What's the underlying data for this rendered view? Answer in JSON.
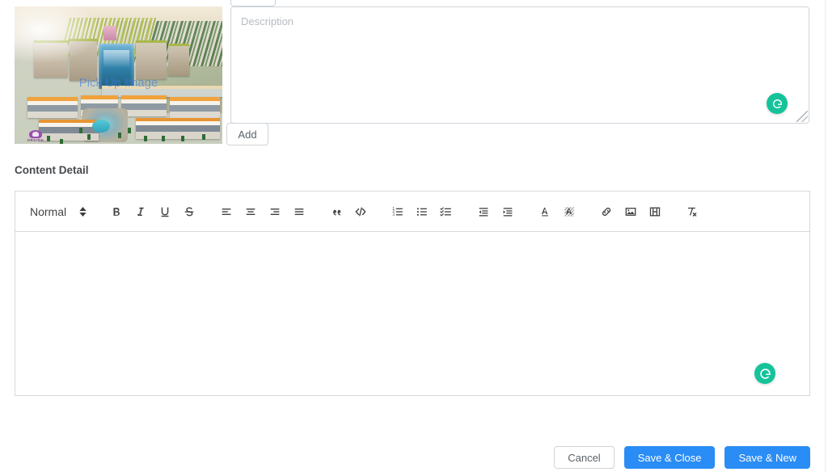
{
  "image_picker": {
    "label": "Pick Up Image",
    "watermark": "ORKIDE"
  },
  "description": {
    "placeholder": "Description",
    "value": ""
  },
  "grammarly": {
    "letter": "G",
    "color": "#15c39a"
  },
  "add_button": {
    "label": "Add"
  },
  "content_detail": {
    "label": "Content Detail"
  },
  "editor": {
    "header_picker": {
      "selected": "Normal"
    },
    "content": "",
    "toolbar": [
      {
        "name": "bold",
        "title": "Bold"
      },
      {
        "name": "italic",
        "title": "Italic"
      },
      {
        "name": "underline",
        "title": "Underline"
      },
      {
        "name": "strike",
        "title": "Strikethrough"
      },
      {
        "name": "align-left",
        "title": "Align left"
      },
      {
        "name": "align-center",
        "title": "Align center"
      },
      {
        "name": "align-right",
        "title": "Align right"
      },
      {
        "name": "align-justify",
        "title": "Justify"
      },
      {
        "name": "blockquote",
        "title": "Blockquote"
      },
      {
        "name": "code-block",
        "title": "Code block"
      },
      {
        "name": "list-ordered",
        "title": "Ordered list"
      },
      {
        "name": "list-bullet",
        "title": "Bullet list"
      },
      {
        "name": "list-check",
        "title": "Check list"
      },
      {
        "name": "outdent",
        "title": "Decrease indent"
      },
      {
        "name": "indent",
        "title": "Increase indent"
      },
      {
        "name": "text-color",
        "title": "Text color"
      },
      {
        "name": "background-color",
        "title": "Background color"
      },
      {
        "name": "link",
        "title": "Insert link"
      },
      {
        "name": "image",
        "title": "Insert image"
      },
      {
        "name": "video",
        "title": "Insert video"
      },
      {
        "name": "clean",
        "title": "Remove formatting"
      }
    ]
  },
  "footer": {
    "cancel_label": "Cancel",
    "save_close_label": "Save & Close",
    "save_new_label": "Save & New",
    "primary_color": "#2a8cf5"
  }
}
